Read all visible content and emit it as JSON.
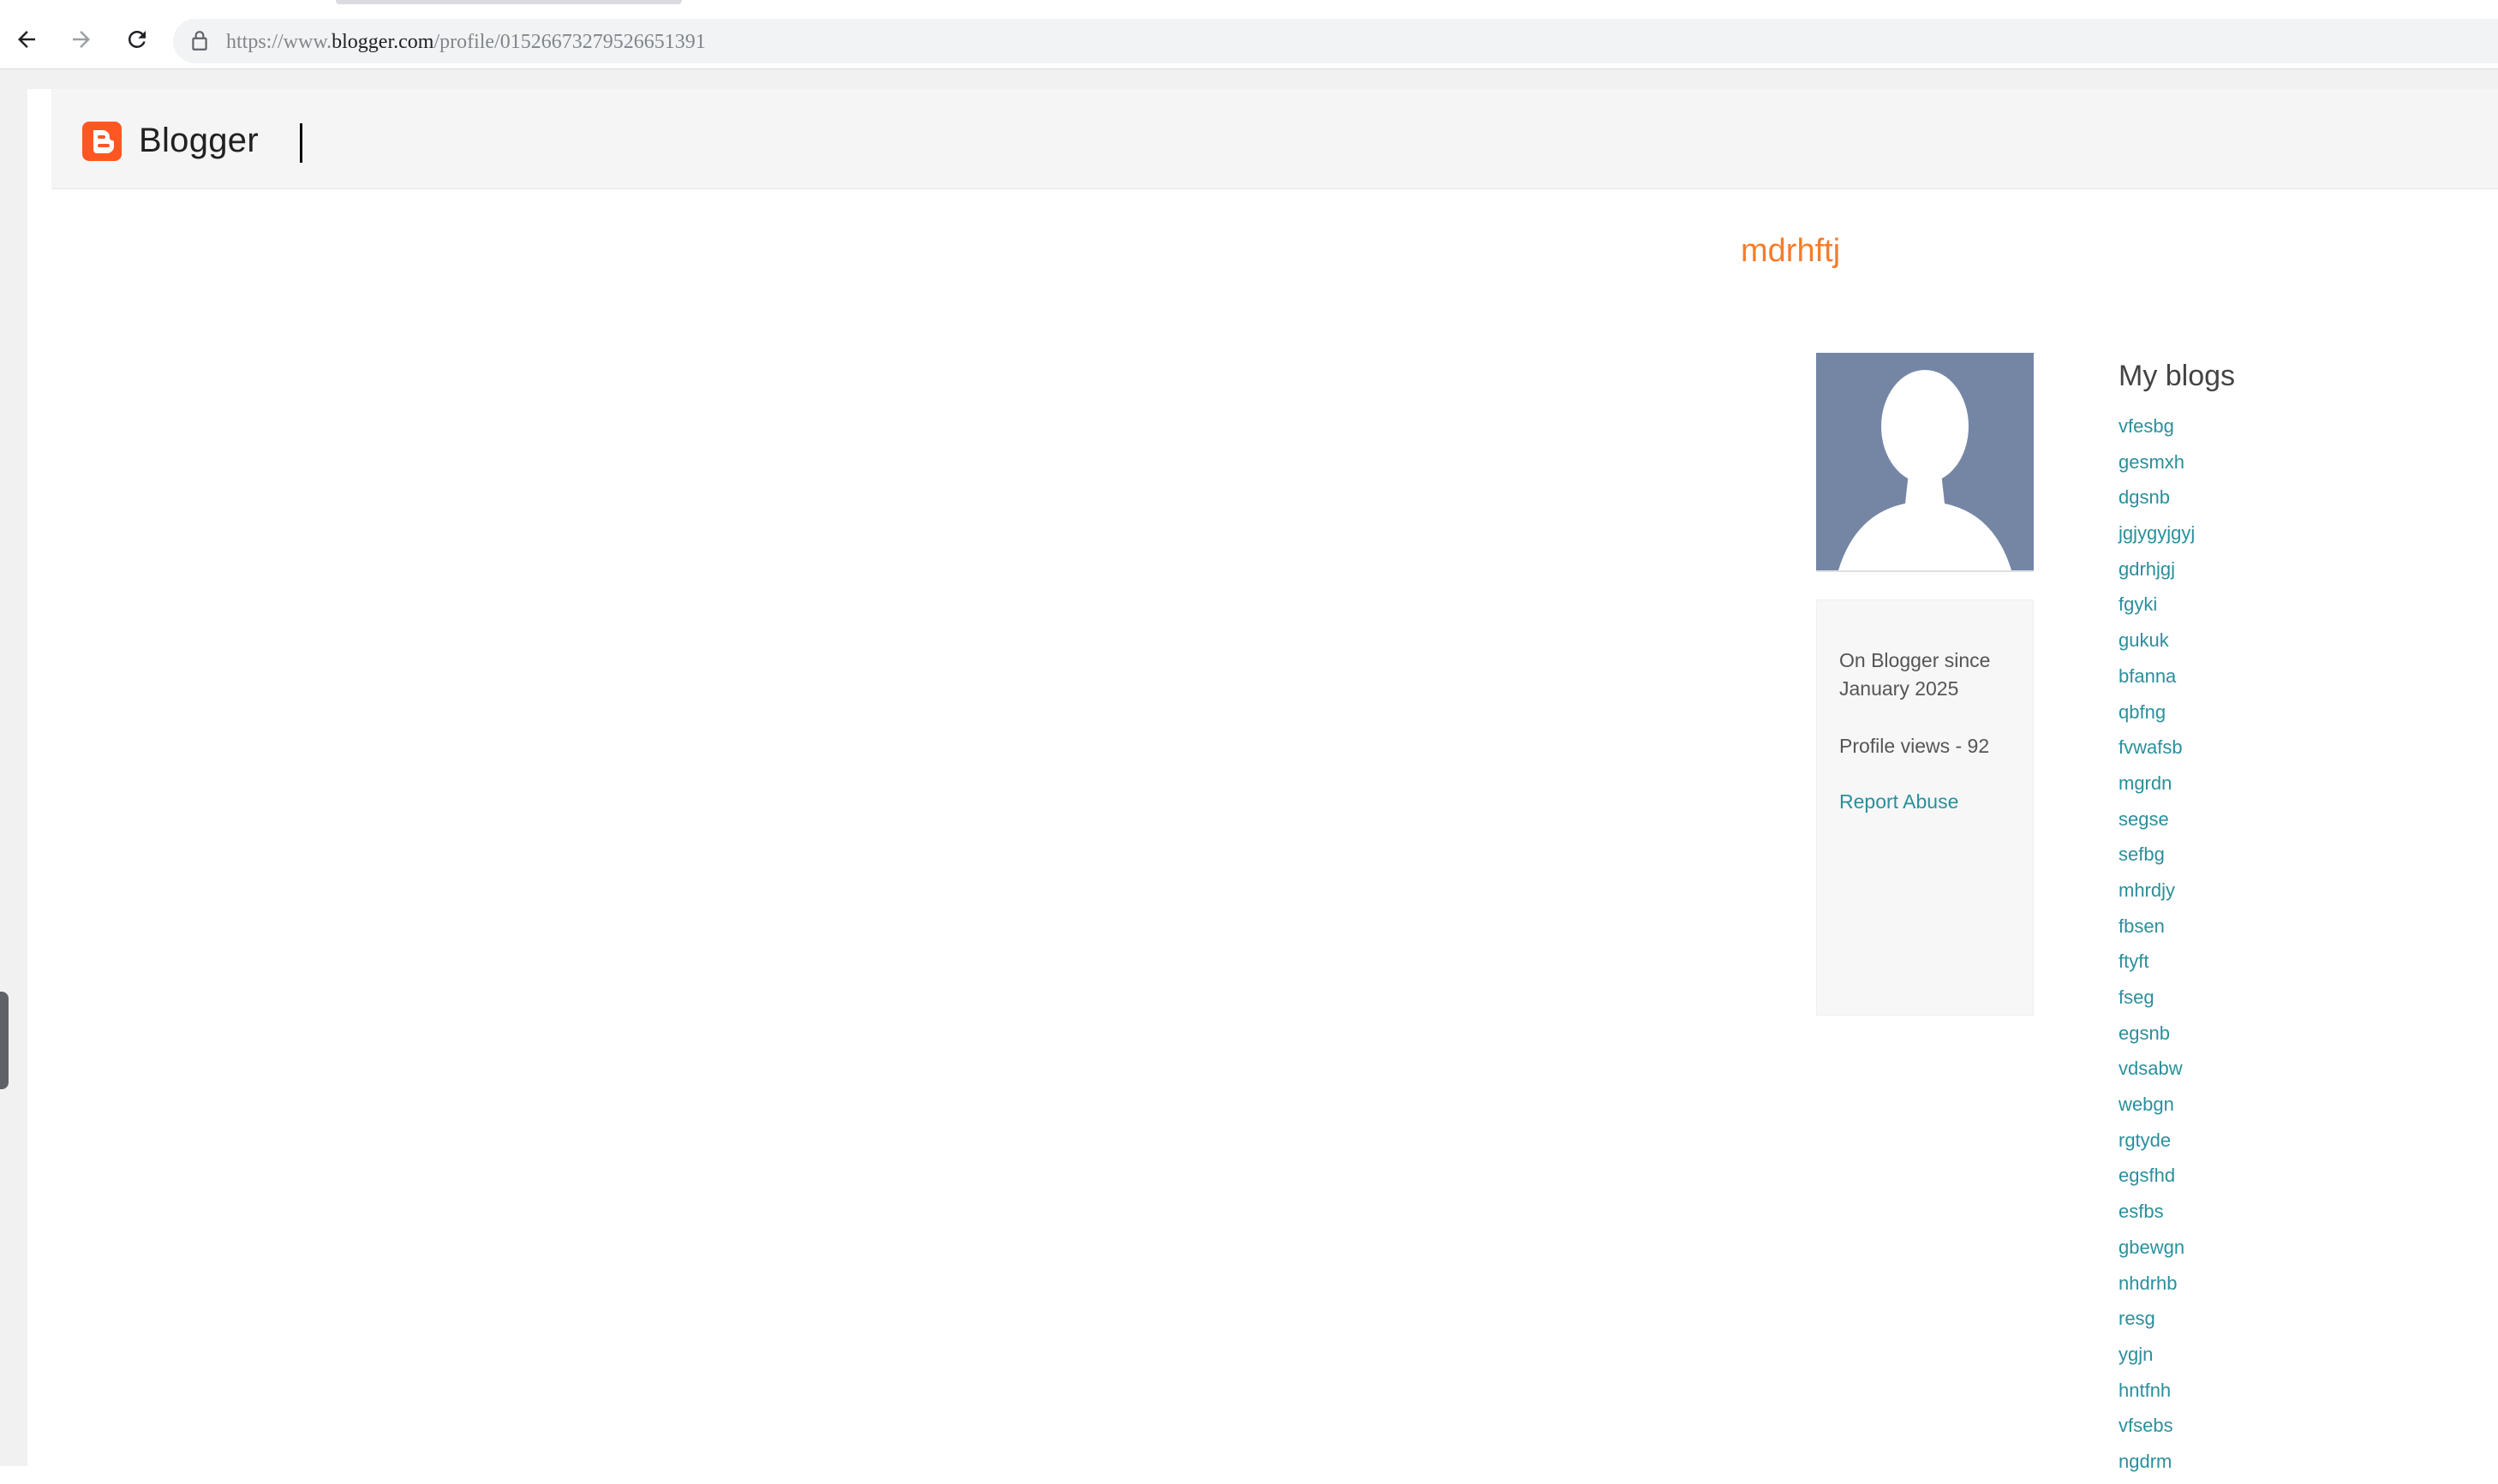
{
  "browser": {
    "url_prefix": "https://www.",
    "url_host": "blogger.com",
    "url_path": "/profile/01526673279526651391"
  },
  "header": {
    "brand": "Blogger"
  },
  "profile": {
    "username": "mdrhftj",
    "since": "On Blogger since January 2025",
    "views": "Profile views - 92",
    "report_label": "Report Abuse"
  },
  "blogs": {
    "title": "My blogs",
    "items": [
      "vfesbg",
      "gesmxh",
      "dgsnb",
      "jgjygyjgyj",
      "gdrhjgj",
      "fgyki",
      "gukuk",
      "bfanna",
      "qbfng",
      "fvwafsb",
      "mgrdn",
      "segse",
      "sefbg",
      "mhrdjy",
      "fbsen",
      "ftyft",
      "fseg",
      "egsnb",
      "vdsabw",
      "webgn",
      "rgtyde",
      "egsfhd",
      "esfbs",
      "gbewgn",
      "nhdrhb",
      "resg",
      "ygjn",
      "hntfnh",
      "vfsebs",
      "ngdrm"
    ]
  },
  "colors": {
    "accent_orange": "#f57d29",
    "link_teal": "#2a8f9c",
    "brand_orange": "#ff5722"
  }
}
